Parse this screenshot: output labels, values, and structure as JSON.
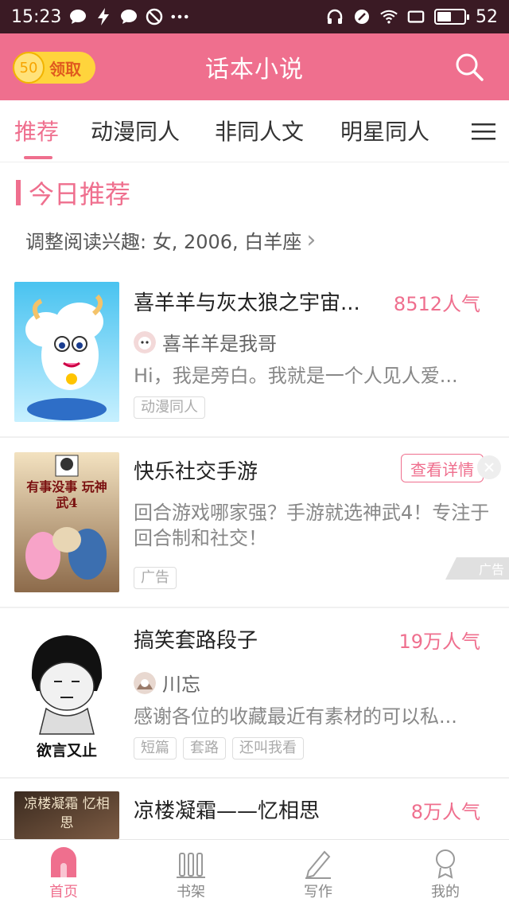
{
  "status_bar": {
    "time": "15:23",
    "battery": "52",
    "battery_level": 0.52
  },
  "header": {
    "coin_count": "50",
    "coin_label": "领取",
    "title": "话本小说"
  },
  "tabs": [
    {
      "label": "推荐",
      "active": true
    },
    {
      "label": "动漫同人"
    },
    {
      "label": "非同人文"
    },
    {
      "label": "明星同人"
    }
  ],
  "section": {
    "title": "今日推荐",
    "interest": "调整阅读兴趣: 女, 2006, 白羊座",
    "interest_arrow": "›"
  },
  "items": [
    {
      "title": "喜羊羊与灰太狼之宇宙...",
      "popularity": "8512人气",
      "author": "喜羊羊是我哥",
      "desc": "Hi，我是旁白。我就是一个人见人爱...",
      "tags": [
        "动漫同人"
      ]
    },
    {
      "title": "快乐社交手游",
      "cta": "查看详情",
      "desc": "回合游戏哪家强？手游就选神武4！专注于回合制和社交！",
      "tags": [
        "广告"
      ],
      "ad_corner": "广告",
      "cover_text": "有事没事 玩神武4"
    },
    {
      "title": "搞笑套路段子",
      "popularity": "19万人气",
      "author": "川忘",
      "desc": "感谢各位的收藏最近有素材的可以私...",
      "tags": [
        "短篇",
        "套路",
        "还叫我看"
      ],
      "cover_text": "欲言又止"
    },
    {
      "title": "凉楼凝霜——忆相思",
      "popularity": "8万人气",
      "cover_text": "凉楼凝霜 忆相思"
    }
  ],
  "bottom_nav": [
    {
      "label": "首页",
      "icon": "home-icon",
      "active": true
    },
    {
      "label": "书架",
      "icon": "bookshelf-icon"
    },
    {
      "label": "写作",
      "icon": "pen-icon"
    },
    {
      "label": "我的",
      "icon": "profile-icon"
    }
  ],
  "colors": {
    "accent": "#ef6f8e",
    "status_bar": "#3a1a24",
    "coin": "#ffd43c"
  }
}
